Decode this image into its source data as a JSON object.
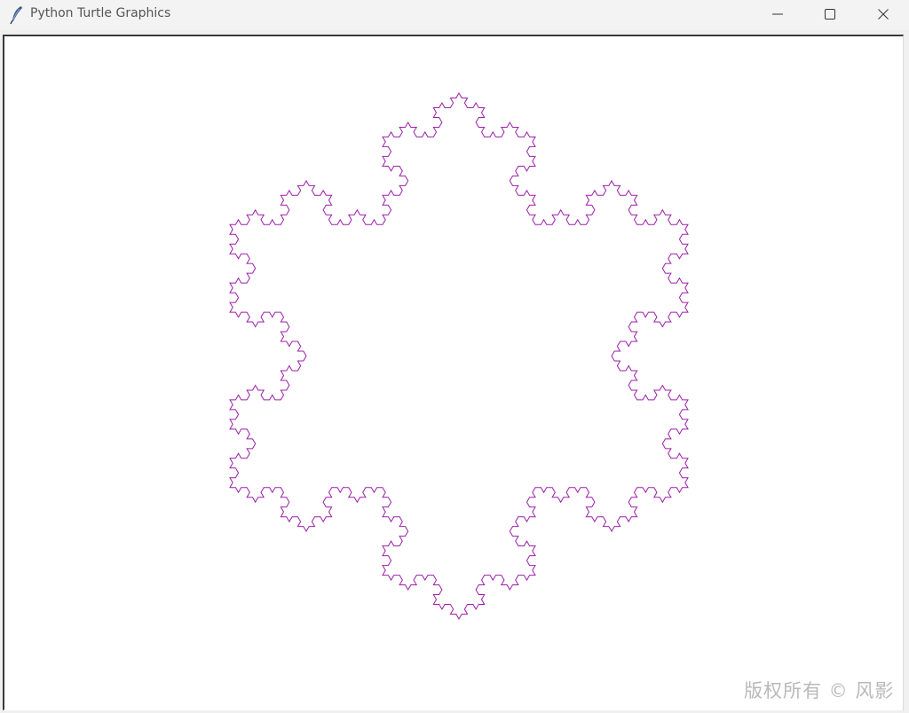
{
  "window": {
    "title": "Python Turtle Graphics",
    "icon": "feather-icon"
  },
  "controls": {
    "minimize_icon": "minimize-icon",
    "maximize_icon": "maximize-icon",
    "close_icon": "close-icon"
  },
  "canvas": {
    "background": "#ffffff",
    "pen_color": "#9b1fa8",
    "shape": "koch-snowflake",
    "koch_depth": 4
  },
  "watermark": {
    "text": "版权所有 © 风影"
  }
}
